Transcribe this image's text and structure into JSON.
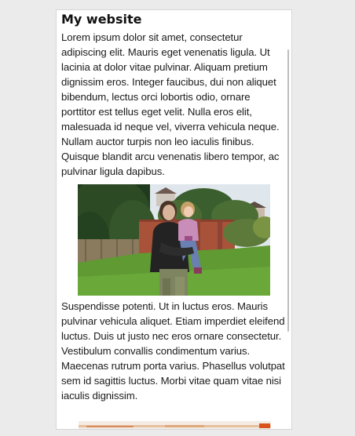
{
  "page": {
    "title": "My website",
    "paragraph_1": "Lorem ipsum dolor sit amet, consectetur adipiscing elit. Mauris eget venenatis ligula. Ut lacinia at dolor vitae pulvinar. Aliquam pretium dignissim eros. Integer faucibus, dui non aliquet bibendum, lectus orci lobortis odio, ornare porttitor est tellus eget velit. Nulla eros elit, malesuada id neque vel, viverra vehicula neque. Nullam auctor turpis non leo iaculis finibus. Quisque blandit arcu venenatis libero tempor, ac pulvinar ligula dapibus.",
    "paragraph_2": "Suspendisse potenti. Ut in luctus eros. Mauris pulvinar vehicula aliquet. Etiam imperdiet eleifend luctus. Duis ut justo nec eros ornare consectetur. Vestibulum convallis condimentum varius. Maecenas rutrum porta varius. Phasellus volutpat sem id sagittis luctus. Morbi vitae quam vitae nisi iaculis dignissim."
  },
  "colors": {
    "page_background": "#ebebeb",
    "viewport_background": "#ffffff",
    "text": "#1a1a1a",
    "scrollbar": "#bdbdbd"
  }
}
